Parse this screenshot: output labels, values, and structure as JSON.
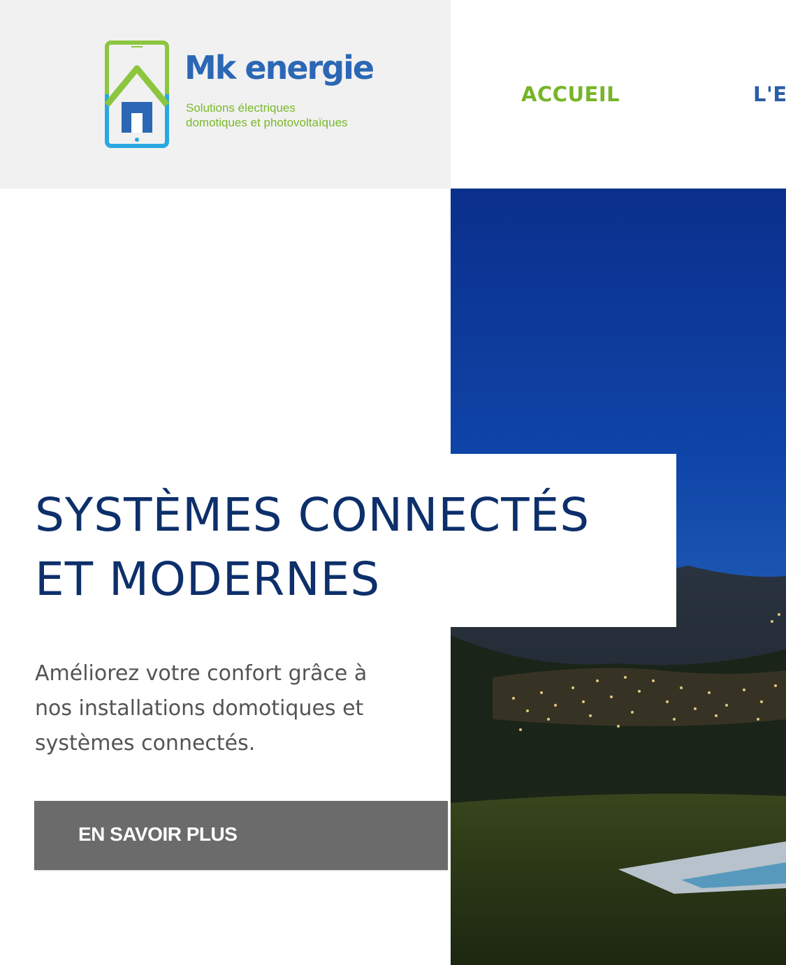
{
  "brand": {
    "name": "Mk energie",
    "tagline_line1": "Solutions électriques",
    "tagline_line2": "domotiques et photovoltaïques",
    "colors": {
      "blue": "#2b67b5",
      "green": "#7ab929",
      "navy": "#0d2f6b"
    },
    "icon": "house-tablet-logo-icon"
  },
  "nav": {
    "items": [
      {
        "label": "ACCUEIL",
        "active": true
      },
      {
        "label": "L'EI",
        "active": false
      }
    ]
  },
  "hero": {
    "title_line1": "SYSTÈMES CONNECTÉS",
    "title_line2": "ET MODERNES",
    "text_line1": "Améliorez votre confort grâce à",
    "text_line2": "nos installations domotiques et",
    "text_line3": "systèmes connectés.",
    "cta_label": "EN SAVOIR PLUS",
    "image": "night-landscape-photo"
  }
}
